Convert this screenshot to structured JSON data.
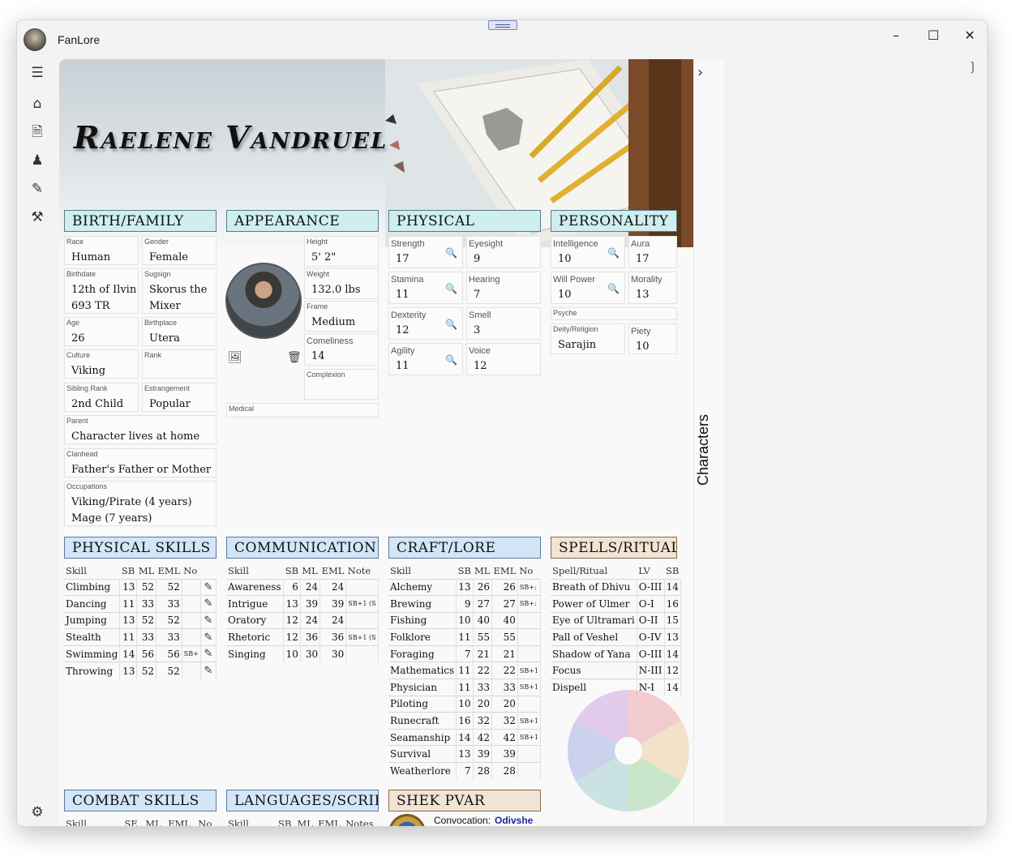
{
  "app": {
    "title": "FanLore"
  },
  "right_pane": {
    "label": "Characters"
  },
  "character": {
    "name": "Raelene Vandruel"
  },
  "birth_family": {
    "title": "BIRTH/FAMILY",
    "fields": [
      {
        "label": "Race",
        "value": "Human"
      },
      {
        "label": "Gender",
        "value": "Female"
      },
      {
        "label": "Birthdate",
        "value": "12th of Ilvin\n693 TR"
      },
      {
        "label": "Sugsign",
        "value": "Skorus the\nMixer"
      },
      {
        "label": "Age",
        "value": "26"
      },
      {
        "label": "Birthplace",
        "value": "Utera"
      },
      {
        "label": "Culture",
        "value": "Viking"
      },
      {
        "label": "Rank",
        "value": ""
      },
      {
        "label": "Sibling Rank",
        "value": "2nd Child"
      },
      {
        "label": "Estrangement",
        "value": "Popular"
      },
      {
        "label": "Parent",
        "value": "Character lives at home"
      },
      {
        "label": "Clanhead",
        "value": "Father's Father or Mother"
      },
      {
        "label": "Occupations",
        "value": "Viking/Pirate (4 years)\nMage (7 years)"
      }
    ]
  },
  "appearance": {
    "title": "APPEARANCE",
    "fields": [
      {
        "label": "Height",
        "value": "5' 2\""
      },
      {
        "label": "Weight",
        "value": "132.0 lbs"
      },
      {
        "label": "Frame",
        "value": "Medium"
      },
      {
        "label": "Comeliness",
        "value": "14"
      },
      {
        "label": "Complexion",
        "value": ""
      },
      {
        "label": "Medical",
        "value": ""
      }
    ]
  },
  "physical": {
    "title": "PHYSICAL",
    "fields": [
      {
        "label": "Strength",
        "value": "17"
      },
      {
        "label": "Eyesight",
        "value": "9"
      },
      {
        "label": "Stamina",
        "value": "11"
      },
      {
        "label": "Hearing",
        "value": "7"
      },
      {
        "label": "Dexterity",
        "value": "12"
      },
      {
        "label": "Smell",
        "value": "3"
      },
      {
        "label": "Agility",
        "value": "11"
      },
      {
        "label": "Voice",
        "value": "12"
      }
    ]
  },
  "personality": {
    "title": "PERSONALITY",
    "fields": [
      {
        "label": "Intelligence",
        "value": "10"
      },
      {
        "label": "Aura",
        "value": "17"
      },
      {
        "label": "Will Power",
        "value": "10"
      },
      {
        "label": "Morality",
        "value": "13"
      },
      {
        "label": "Psyche",
        "value": ""
      },
      {
        "label": "Deity/Religion",
        "value": "Sarajin"
      },
      {
        "label": "Piety",
        "value": "10"
      }
    ]
  },
  "physical_skills": {
    "title": "PHYSICAL SKILLS",
    "columns": [
      "Skill",
      "SB",
      "ML",
      "EML",
      "No"
    ],
    "rows": [
      [
        "Climbing",
        "13",
        "52",
        "52",
        ""
      ],
      [
        "Dancing",
        "11",
        "33",
        "33",
        ""
      ],
      [
        "Jumping",
        "13",
        "52",
        "52",
        ""
      ],
      [
        "Stealth",
        "11",
        "33",
        "33",
        ""
      ],
      [
        "Swimming",
        "14",
        "56",
        "56",
        "SB+"
      ],
      [
        "Throwing",
        "13",
        "52",
        "52",
        ""
      ]
    ]
  },
  "communication": {
    "title": "COMMUNICATION",
    "columns": [
      "Skill",
      "SB",
      "ML",
      "EML",
      "Note"
    ],
    "rows": [
      [
        "Awareness",
        "6",
        "24",
        "24",
        ""
      ],
      [
        "Intrigue",
        "13",
        "39",
        "39",
        "SB+1 (S"
      ],
      [
        "Oratory",
        "12",
        "24",
        "24",
        ""
      ],
      [
        "Rhetoric",
        "12",
        "36",
        "36",
        "SB+1 (S"
      ],
      [
        "Singing",
        "10",
        "30",
        "30",
        ""
      ]
    ]
  },
  "craft_lore": {
    "title": "CRAFT/LORE",
    "columns": [
      "Skill",
      "SB",
      "ML",
      "EML",
      "No"
    ],
    "rows": [
      [
        "Alchemy",
        "13",
        "26",
        "26",
        "SB+:"
      ],
      [
        "Brewing",
        "9",
        "27",
        "27",
        "SB+:"
      ],
      [
        "Fishing",
        "10",
        "40",
        "40",
        ""
      ],
      [
        "Folklore",
        "11",
        "55",
        "55",
        ""
      ],
      [
        "Foraging",
        "7",
        "21",
        "21",
        ""
      ],
      [
        "Mathematics",
        "11",
        "22",
        "22",
        "SB+1"
      ],
      [
        "Physician",
        "11",
        "33",
        "33",
        "SB+1"
      ],
      [
        "Piloting",
        "10",
        "20",
        "20",
        ""
      ],
      [
        "Runecraft",
        "16",
        "32",
        "32",
        "SB+1"
      ],
      [
        "Seamanship",
        "14",
        "42",
        "42",
        "SB+1"
      ],
      [
        "Survival",
        "13",
        "39",
        "39",
        ""
      ],
      [
        "Weatherlore",
        "7",
        "28",
        "28",
        ""
      ]
    ]
  },
  "spells": {
    "title": "SPELLS/RITUALS",
    "columns": [
      "Spell/Ritual",
      "LV",
      "SB"
    ],
    "rows": [
      [
        "Breath of Dhivu",
        "O-III",
        "14"
      ],
      [
        "Power of Ulmer",
        "O-I",
        "16"
      ],
      [
        "Eye of Ultramari",
        "O-II",
        "15"
      ],
      [
        "Pall of Veshel",
        "O-IV",
        "13"
      ],
      [
        "Shadow of Yana",
        "O-III",
        "14"
      ],
      [
        "Focus",
        "N-III",
        "12"
      ],
      [
        "Dispell",
        "N-I",
        "14"
      ]
    ]
  },
  "combat_skills": {
    "title": "COMBAT SKILLS",
    "columns": [
      "Skill",
      "SE",
      "ML",
      "EML",
      "No"
    ]
  },
  "languages": {
    "title": "LANGUAGES/SCRIPTS",
    "columns": [
      "Skill",
      "SB",
      "ML",
      "EML",
      "Notes"
    ]
  },
  "shek_pvar": {
    "title": "SHEK PVAR",
    "convocation_label": "Convocation:",
    "convocation": "Odivshe"
  }
}
